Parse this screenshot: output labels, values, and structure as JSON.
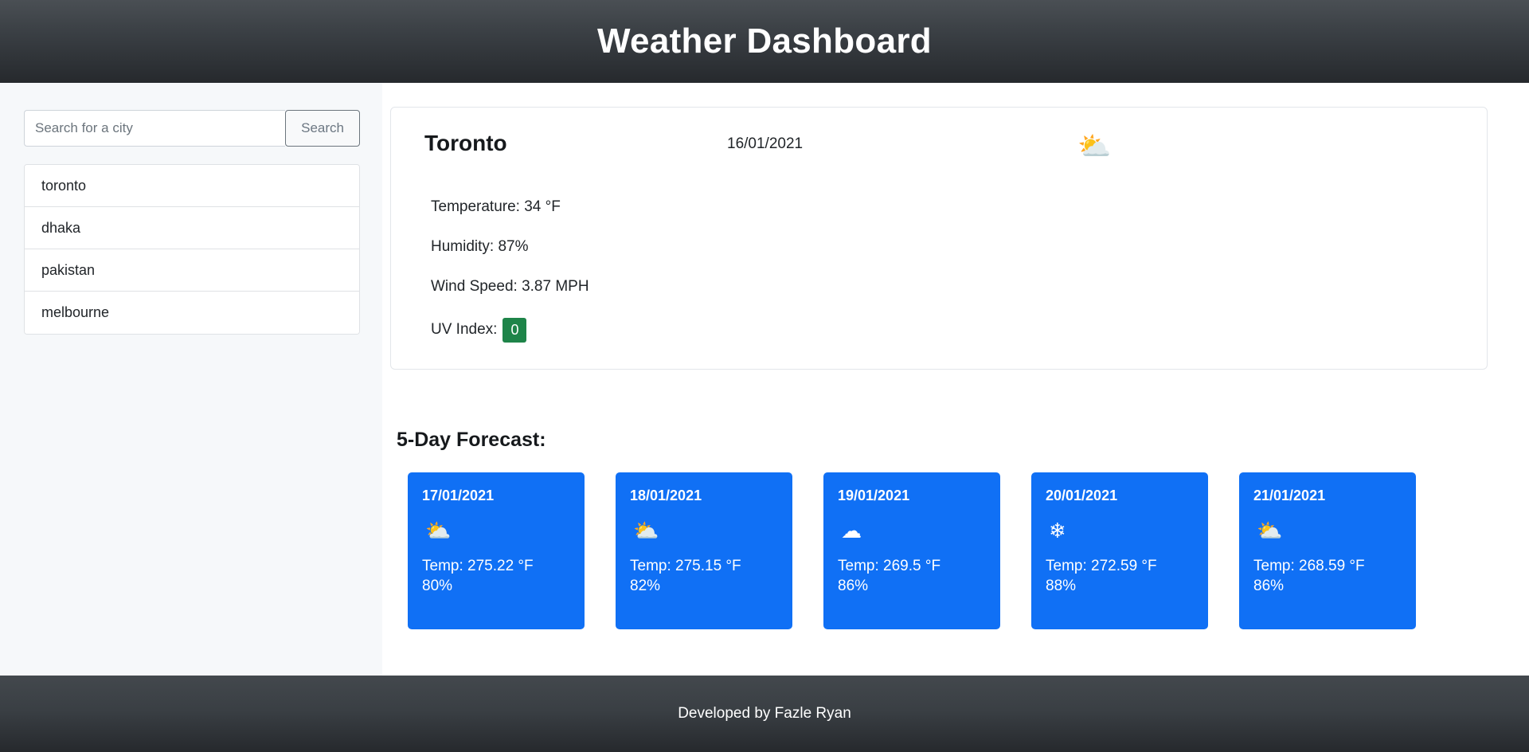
{
  "header": {
    "title": "Weather Dashboard"
  },
  "sidebar": {
    "search": {
      "placeholder": "Search for a city",
      "value": "",
      "button_label": "Search"
    },
    "cities": [
      {
        "name": "toronto"
      },
      {
        "name": "dhaka"
      },
      {
        "name": "pakistan"
      },
      {
        "name": "melbourne"
      }
    ]
  },
  "current": {
    "city": "Toronto",
    "date": "16/01/2021",
    "icon": "broken-clouds",
    "icon_glyph": "⛅",
    "temperature_label": "Temperature: 34 °F",
    "humidity_label": "Humidity: 87%",
    "wind_label": "Wind Speed: 3.87 MPH",
    "uv_label": "UV Index:",
    "uv_value": "0",
    "uv_color": "#1e8449"
  },
  "forecast": {
    "title": "5-Day Forecast:",
    "accent_color": "#1070f5",
    "days": [
      {
        "date": "17/01/2021",
        "icon": "broken-clouds",
        "icon_glyph": "⛅",
        "temp": "Temp: 275.22 °F",
        "humidity": "80%"
      },
      {
        "date": "18/01/2021",
        "icon": "broken-clouds",
        "icon_glyph": "⛅",
        "temp": "Temp: 275.15 °F",
        "humidity": "82%"
      },
      {
        "date": "19/01/2021",
        "icon": "overcast-cloud",
        "icon_glyph": "☁",
        "temp": "Temp: 269.5 °F",
        "humidity": "86%"
      },
      {
        "date": "20/01/2021",
        "icon": "snowflake",
        "icon_glyph": "❄",
        "temp": "Temp: 272.59 °F",
        "humidity": "88%"
      },
      {
        "date": "21/01/2021",
        "icon": "broken-clouds",
        "icon_glyph": "⛅",
        "temp": "Temp: 268.59 °F",
        "humidity": "86%"
      }
    ]
  },
  "footer": {
    "text": "Developed by Fazle Ryan"
  }
}
